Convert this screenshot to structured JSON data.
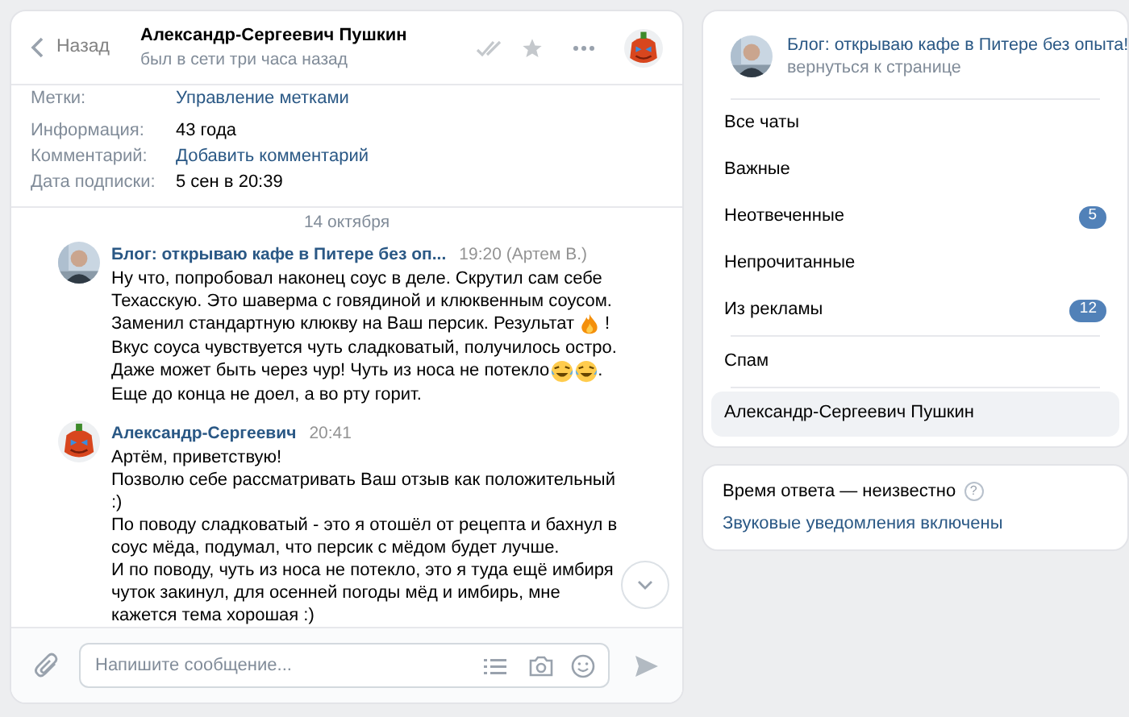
{
  "header": {
    "back": "Назад",
    "name": "Александр-Сергеевич Пушкин",
    "status": "был в сети три часа назад"
  },
  "info": [
    {
      "label": "Метки:",
      "value": "Управление метками",
      "kind": "link"
    },
    {
      "label": "Информация:",
      "value": "43 года",
      "kind": "text"
    },
    {
      "label": "Комментарий:",
      "value": "Добавить комментарий",
      "kind": "link"
    },
    {
      "label": "Дата подписки:",
      "value": "5 сен в 20:39",
      "kind": "text"
    }
  ],
  "date": "14 октября",
  "messages": [
    {
      "kind": "community",
      "author": "Блог: открываю кафе в Питере без оп...",
      "time": "19:20 (Артем В.)",
      "lines": [
        [
          {
            "kind": "text",
            "text": "Ну что, попробовал наконец соус в деле. Скрутил сам себе"
          }
        ],
        [
          {
            "kind": "text",
            "text": "Техасскую. Это шаверма с говядиной и клюквенным соусом."
          }
        ],
        [
          {
            "kind": "text",
            "text": "Заменил стандартную клюкву на Ваш персик. Результат"
          },
          {
            "kind": "fire"
          },
          {
            "kind": "text",
            "text": "!"
          }
        ],
        [
          {
            "kind": "text",
            "text": "Вкус соуса чувствуется чуть сладковатый, получилось остро."
          }
        ],
        [
          {
            "kind": "text",
            "text": "Даже может быть через чур! Чуть из носа не потекло"
          },
          {
            "kind": "laugh"
          },
          {
            "kind": "laugh"
          },
          {
            "kind": "text",
            "text": "."
          }
        ],
        [
          {
            "kind": "text",
            "text": "Еще до конца не доел, а во рту горит."
          }
        ]
      ]
    },
    {
      "kind": "contact",
      "author": "Александр-Сергеевич",
      "time": "20:41",
      "lines": [
        [
          {
            "kind": "text",
            "text": "Артём, приветствую!"
          }
        ],
        [
          {
            "kind": "text",
            "text": "Позволю себе рассматривать Ваш отзыв как положительный"
          }
        ],
        [
          {
            "kind": "text",
            "text": ":)"
          }
        ],
        [
          {
            "kind": "text",
            "text": "По поводу сладковатый - это я отошёл от рецепта и бахнул в"
          }
        ],
        [
          {
            "kind": "text",
            "text": "соус мёда, подумал, что персик с мёдом будет лучше."
          }
        ],
        [
          {
            "kind": "text",
            "text": "И по поводу, чуть из носа не потекло, это я туда ещё имбиря"
          }
        ],
        [
          {
            "kind": "text",
            "text": "чуток закинул, для осенней погоды мёд и имбирь, мне"
          }
        ],
        [
          {
            "kind": "text",
            "text": "кажется тема хорошая :)"
          }
        ]
      ]
    }
  ],
  "composer": {
    "placeholder": "Напишите сообщение..."
  },
  "community": {
    "title": "Блог: открываю кафе в Питере без опыта!",
    "link": "вернуться к странице"
  },
  "folders": [
    {
      "label": "Все чаты",
      "selected": false
    },
    {
      "label": "Важные",
      "selected": false
    },
    {
      "label": "Неотвеченные",
      "badge": "5",
      "selected": false
    },
    {
      "label": "Непрочитанные",
      "selected": false
    },
    {
      "label": "Из рекламы",
      "badge": "12",
      "selected": false,
      "divider": true
    },
    {
      "label": "Спам",
      "selected": false,
      "divider": true
    },
    {
      "label": "Александр-Сергеевич Пушкин",
      "selected": true
    }
  ],
  "response": {
    "text": "Время ответа — неизвестно",
    "help": "?",
    "sound": "Звуковые уведомления включены"
  }
}
